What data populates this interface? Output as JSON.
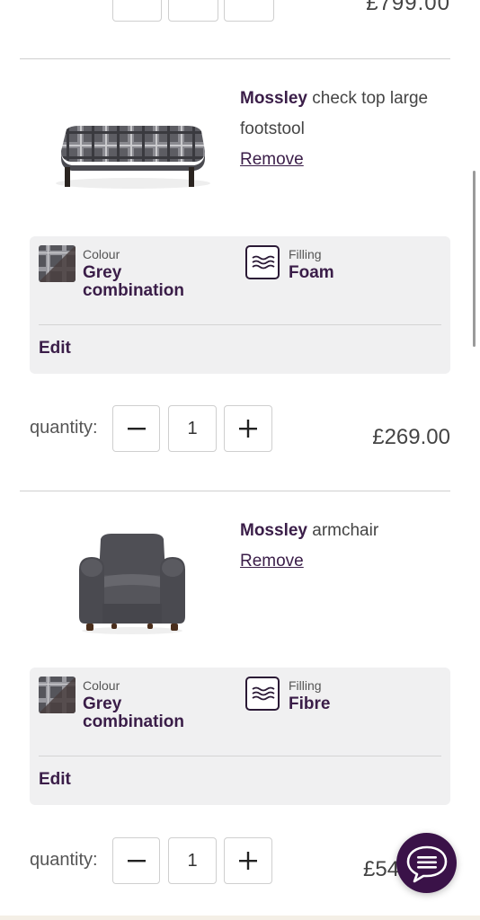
{
  "top_row": {
    "price_partial": "£799.00"
  },
  "items": [
    {
      "brand": "Mossley",
      "name_rest": " check top large footstool",
      "remove_label": "Remove",
      "image": "footstool-image",
      "colour_label": "Colour",
      "colour_value": "Grey combination",
      "filling_label": "Filling",
      "filling_value": "Foam",
      "edit_label": "Edit",
      "quantity_label": "quantity:",
      "quantity_value": "1",
      "price": "£269.00"
    },
    {
      "brand": "Mossley",
      "name_rest": " armchair",
      "remove_label": "Remove",
      "image": "armchair-image",
      "colour_label": "Colour",
      "colour_value": "Grey combination",
      "filling_label": "Filling",
      "filling_value": "Fibre",
      "edit_label": "Edit",
      "quantity_label": "quantity:",
      "quantity_value": "1",
      "price": "£54"
    }
  ],
  "icons": {
    "minus": "minus-icon",
    "plus": "plus-icon",
    "filling": "waves-icon",
    "chat": "chat-bubble-icon"
  },
  "colors": {
    "brand_purple": "#3a1d48",
    "chat_button": "#3a1248",
    "panel_bg": "#f0f0f1"
  }
}
